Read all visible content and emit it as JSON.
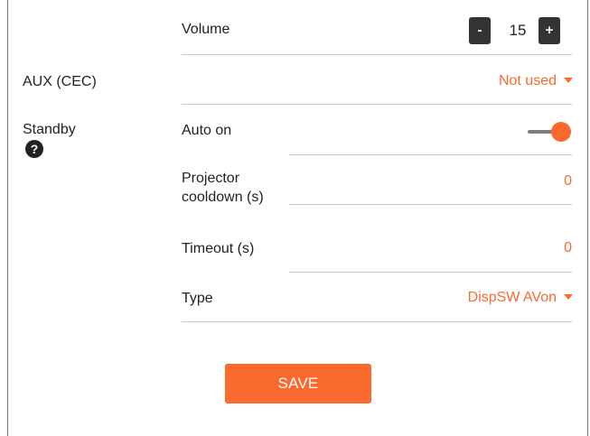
{
  "volume": {
    "label": "Volume",
    "value": "15",
    "decrease_label": "-",
    "increase_label": "+"
  },
  "aux": {
    "label": "AUX (CEC)",
    "value": "Not used"
  },
  "standby": {
    "label": "Standby",
    "help_icon": "?",
    "auto_on": {
      "label": "Auto on",
      "enabled": true
    },
    "projector_cooldown": {
      "label_line1": "Projector",
      "label_line2": "cooldown (s)",
      "value": "0"
    },
    "timeout": {
      "label": "Timeout (s)",
      "value": "0"
    },
    "type": {
      "label": "Type",
      "value": "DispSW AVon"
    }
  },
  "save_label": "SAVE",
  "colors": {
    "accent": "#fa6a2e",
    "dark_button": "#333333",
    "divider": "#c8c8c8"
  },
  "icons": {
    "help": "question-circle-icon",
    "dropdown": "caret-down-icon",
    "toggle": "toggle-switch-icon"
  }
}
